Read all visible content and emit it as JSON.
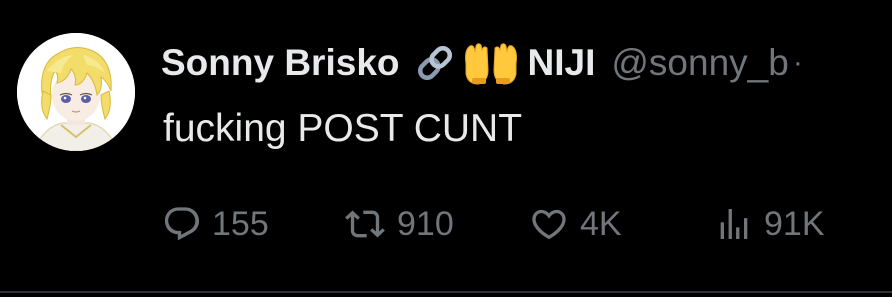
{
  "tweet": {
    "author": {
      "display_name": "Sonny Brisko",
      "name_suffix": "NIJI",
      "handle": "@sonny_b",
      "separator": "·",
      "emojis": [
        "link-emoji",
        "raising-hands-emoji"
      ]
    },
    "text": "fucking POST CUNT",
    "actions": {
      "reply_count": "155",
      "retweet_count": "910",
      "like_count": "4K",
      "views_count": "91K"
    }
  },
  "colors": {
    "background": "#000000",
    "primary_text": "#e7e9ea",
    "secondary_text": "#71767b",
    "divider": "#2f3336"
  },
  "icons": {
    "reply": "reply-icon",
    "retweet": "retweet-icon",
    "like": "heart-icon",
    "views": "views-bar-chart-icon"
  }
}
